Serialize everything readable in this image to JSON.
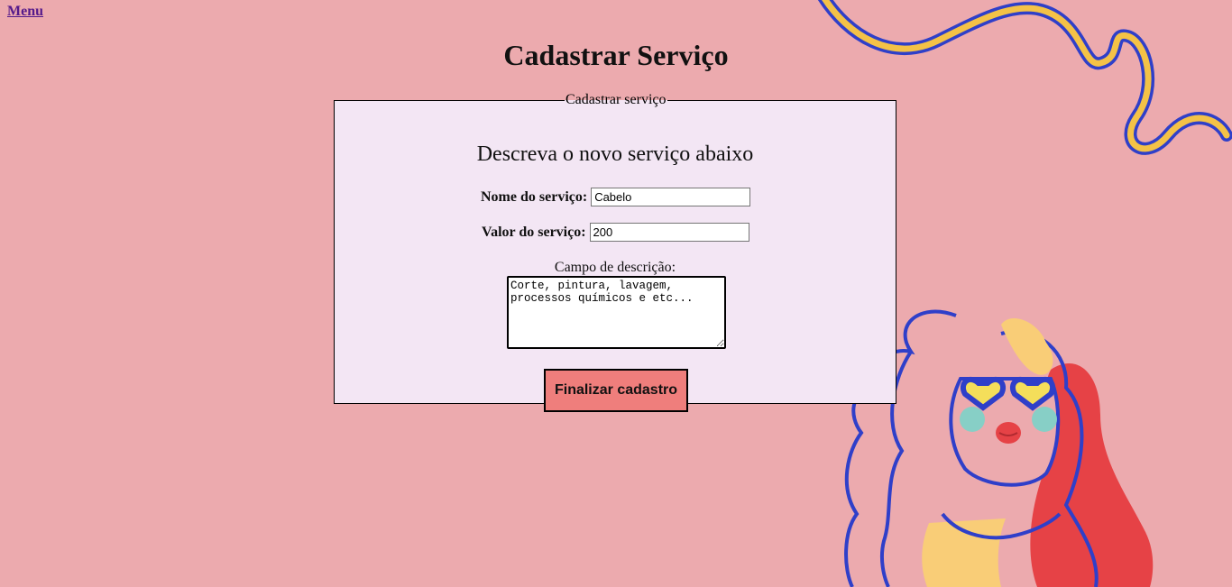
{
  "nav": {
    "menu_label": "Menu"
  },
  "page": {
    "title": "Cadastrar Serviço"
  },
  "form": {
    "legend": "Cadastrar serviço",
    "subtitle": "Descreva o novo serviço abaixo",
    "name_label": "Nome do serviço:",
    "name_value": "Cabelo",
    "price_label": "Valor do serviço:",
    "price_value": "200",
    "description_label": "Campo de descrição:",
    "description_value": "Corte, pintura, lavagem, processos químicos e etc...",
    "submit_label": "Finalizar cadastro"
  },
  "colors": {
    "background": "#ecaaae",
    "form_background": "#f3e6f4",
    "button": "#ef7e7c",
    "illustration_blue": "#2f3fc9",
    "illustration_yellow": "#f4c247",
    "illustration_red": "#e64246"
  }
}
